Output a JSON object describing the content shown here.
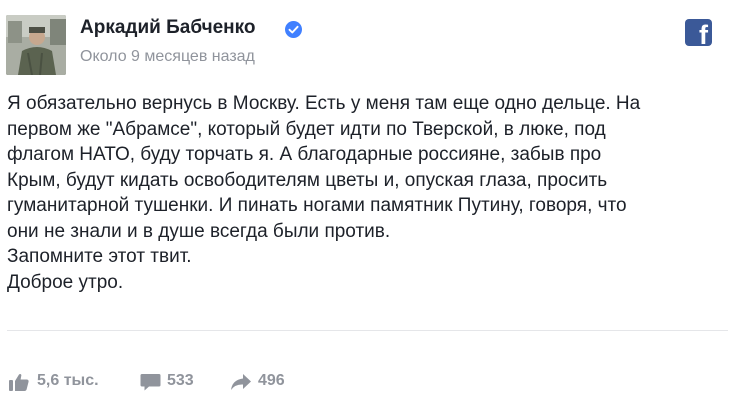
{
  "post": {
    "author": {
      "name": "Аркадий Бабченко",
      "verified": true,
      "avatar_icon": "profile-photo"
    },
    "timestamp": "Около 9 месяцев назад",
    "source_icon": "facebook-logo-icon",
    "source_glyph": "f",
    "body_lines": [
      "Я обязательно вернусь в Москву. Есть у меня там еще одно дельце. На",
      "первом же \"Абрамсе\", который будет идти по Тверской, в люке, под",
      "флагом НАТО, буду торчать я. А благодарные россияне, забыв про",
      "Крым, будут кидать освободителям цветы и, опуская глаза, просить",
      "гуманитарной тушенки. И пинать ногами памятник Путину, говоря, что",
      "они не знали и в душе всегда были против.",
      "Запомните этот твит.",
      "Доброе утро."
    ],
    "stats": {
      "likes": "5,6 тыс.",
      "comments": "533",
      "shares": "496"
    }
  },
  "colors": {
    "brand": "#3b5998",
    "verified": "#4080ff",
    "text": "#1d2129",
    "muted": "#90949c",
    "divider": "#e5e6e9"
  }
}
